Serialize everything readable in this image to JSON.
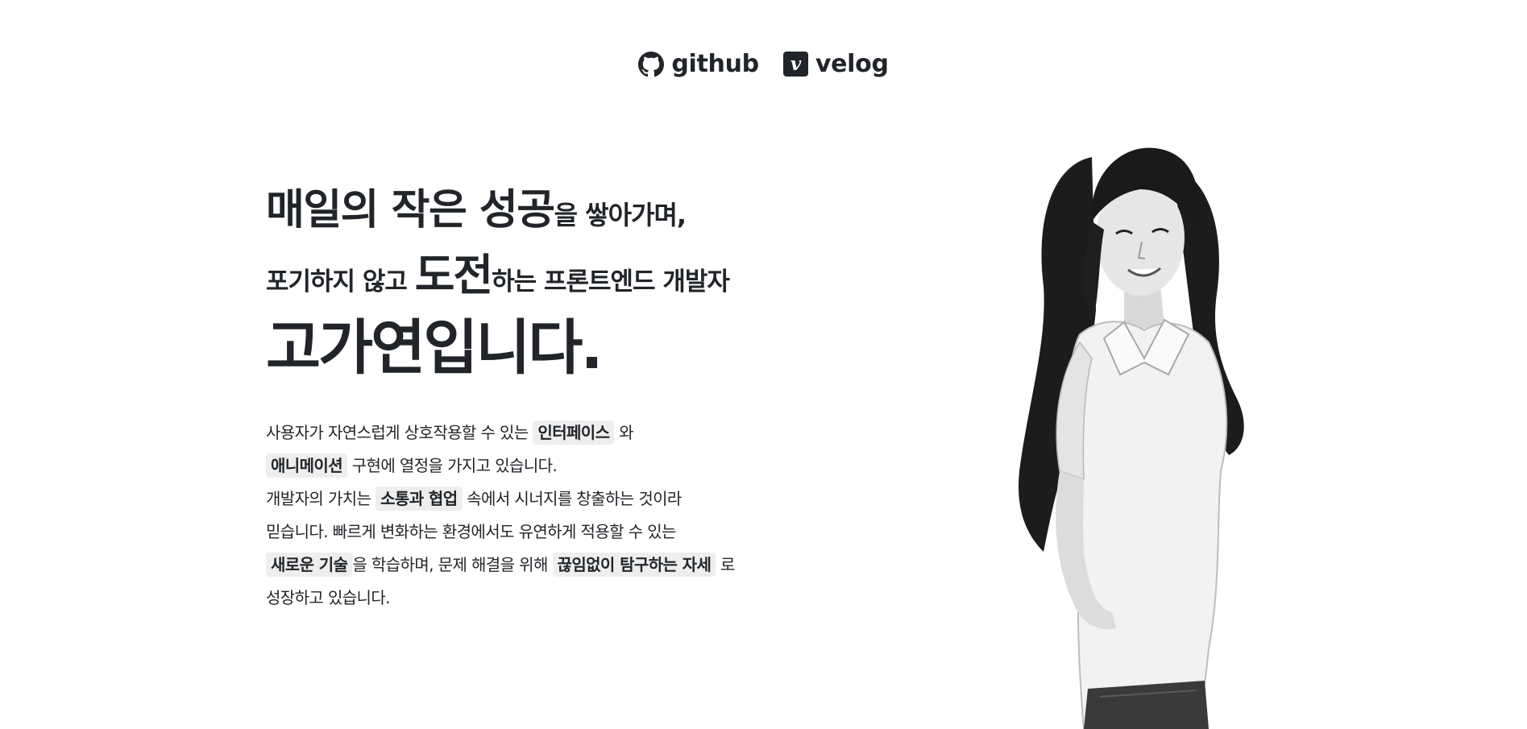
{
  "nav": {
    "github_label": "github",
    "velog_label": "velog",
    "velog_icon_letter": "v"
  },
  "hero": {
    "line1_big": "매일의 작은 성공",
    "line1_small": "을 쌓아가며,",
    "line2_a": "포기하지 않고 ",
    "line2_big": "도전",
    "line2_b": "하는 프론트엔드 개발자",
    "line3": "고가연입니다."
  },
  "description": {
    "p1_a": "사용자가 자연스럽게 상호작용할 수 있는 ",
    "chip1": "인터페이스",
    "p1_b": " 와",
    "chip2": "애니메이션",
    "p2_a": " 구현에 열정을 가지고 있습니다.",
    "p3_a": "개발자의 가치는 ",
    "chip3": "소통과 협업",
    "p3_b": " 속에서 시너지를 창출하는 것이라",
    "p4_a": "믿습니다. 빠르게 변화하는 환경에서도 유연하게 적용할 수 있는",
    "chip4": "새로운 기술",
    "p5_a": "을 학습하며, 문제 해결을 위해 ",
    "chip5": "끊임없이 탐구하는 자세",
    "p5_b": " 로",
    "p6_a": "성장하고 있습니다."
  },
  "colors": {
    "text": "#212529",
    "chip_bg": "#eeeeee",
    "background": "#ffffff"
  }
}
